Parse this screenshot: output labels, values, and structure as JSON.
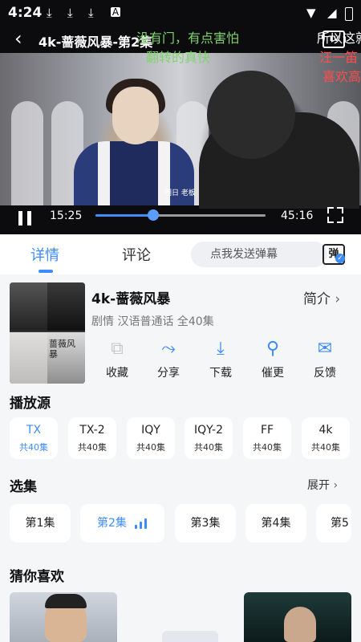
{
  "status": {
    "time": "4:24"
  },
  "player": {
    "title": "4k-蔷薇风暴-第2集",
    "subtitle_text": "明日 老板",
    "current_time": "15:25",
    "duration": "45:16",
    "progress": 0.34,
    "danmaku": [
      {
        "text": "没有门，有点害怕",
        "color": "#7fd36b"
      },
      {
        "text": "翻转的真快",
        "color": "#7fd36b"
      },
      {
        "text": "所以这就",
        "color": "#ffffff"
      },
      {
        "text": "汪一笛",
        "color": "#ff4d4d"
      },
      {
        "text": "喜欢高",
        "color": "#ff4d4d"
      }
    ],
    "tv_badge": "TV"
  },
  "tabs": {
    "details": "详情",
    "comments": "评论",
    "danmaku_placeholder": "点我发送弹幕",
    "danmaku_button": "弹"
  },
  "show": {
    "title": "4k-蔷薇风暴",
    "intro_label": "简介",
    "meta": "剧情 汉语普通话 全40集",
    "poster_title": "蔷薇风暴"
  },
  "actions": [
    {
      "label": "收藏",
      "icon": "favorite-icon"
    },
    {
      "label": "分享",
      "icon": "share-icon"
    },
    {
      "label": "下载",
      "icon": "download-icon"
    },
    {
      "label": "催更",
      "icon": "search-icon"
    },
    {
      "label": "反馈",
      "icon": "feedback-icon"
    }
  ],
  "sources_heading": "播放源",
  "sources": [
    {
      "name": "TX",
      "count": "共40集",
      "active": true
    },
    {
      "name": "TX-2",
      "count": "共40集"
    },
    {
      "name": "IQY",
      "count": "共40集"
    },
    {
      "name": "IQY-2",
      "count": "共40集"
    },
    {
      "name": "FF",
      "count": "共40集"
    },
    {
      "name": "4k",
      "count": "共40集"
    }
  ],
  "episodes_heading": "选集",
  "expand_label": "展开",
  "episodes": [
    "第1集",
    "第2集",
    "第3集",
    "第4集",
    "第5"
  ],
  "recommend_heading": "猜你喜欢",
  "colors": {
    "accent": "#3d8bfd",
    "background": "#f5f6f8"
  }
}
